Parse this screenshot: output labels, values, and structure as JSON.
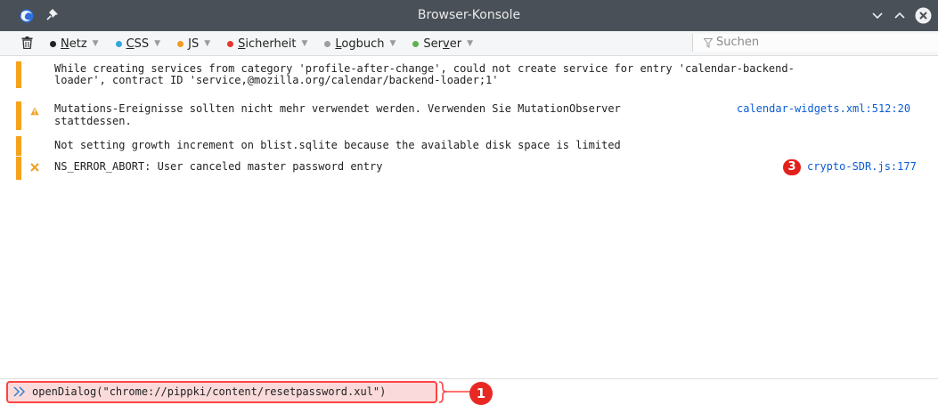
{
  "window": {
    "title": "Browser-Konsole",
    "icons": {
      "app": "firefox-icon",
      "pin": "pin-icon",
      "minimize": "chevron-down-icon",
      "maximize": "chevron-up-icon",
      "close": "close-icon"
    }
  },
  "toolbar": {
    "clear_icon": "trash-icon",
    "filters": [
      {
        "id": "netz",
        "underline": "N",
        "rest": "etz",
        "color": "#222222"
      },
      {
        "id": "css",
        "underline": "C",
        "rest": "SS",
        "color": "#31a6e0"
      },
      {
        "id": "js",
        "underline": "J",
        "rest": "S",
        "color": "#f39a24"
      },
      {
        "id": "sicherheit",
        "underline": "S",
        "rest": "icherheit",
        "color": "#e6352e"
      },
      {
        "id": "logbuch",
        "underline": "L",
        "rest": "ogbuch",
        "color": "#9e9e9e"
      },
      {
        "id": "server",
        "pre": "Ser",
        "underline": "v",
        "rest": "er",
        "color": "#5fb14e"
      }
    ],
    "search_placeholder": "Suchen"
  },
  "messages": [
    {
      "type": "log",
      "text1": "While creating services from category 'profile-after-change', could not create service for entry 'calendar-backend-",
      "text2": "loader', contract ID 'service,@mozilla.org/calendar/backend-loader;1'"
    },
    {
      "type": "warning",
      "text1": "Mutations-Ereignisse sollten nicht mehr verwendet werden. Verwenden Sie MutationObserver",
      "text2": "stattdessen.",
      "source": "calendar-widgets.xml:512:20"
    },
    {
      "type": "log",
      "text1": "Not setting growth increment on blist.sqlite because the available disk space is limited"
    },
    {
      "type": "error",
      "text1": "NS_ERROR_ABORT: User canceled master password entry",
      "source": "crypto-SDR.js:177",
      "badge": "3"
    }
  ],
  "input": {
    "command": "openDialog(\"chrome://pippki/content/resetpassword.xul\")",
    "callout": "1",
    "highlight_color": "#ff4440"
  }
}
